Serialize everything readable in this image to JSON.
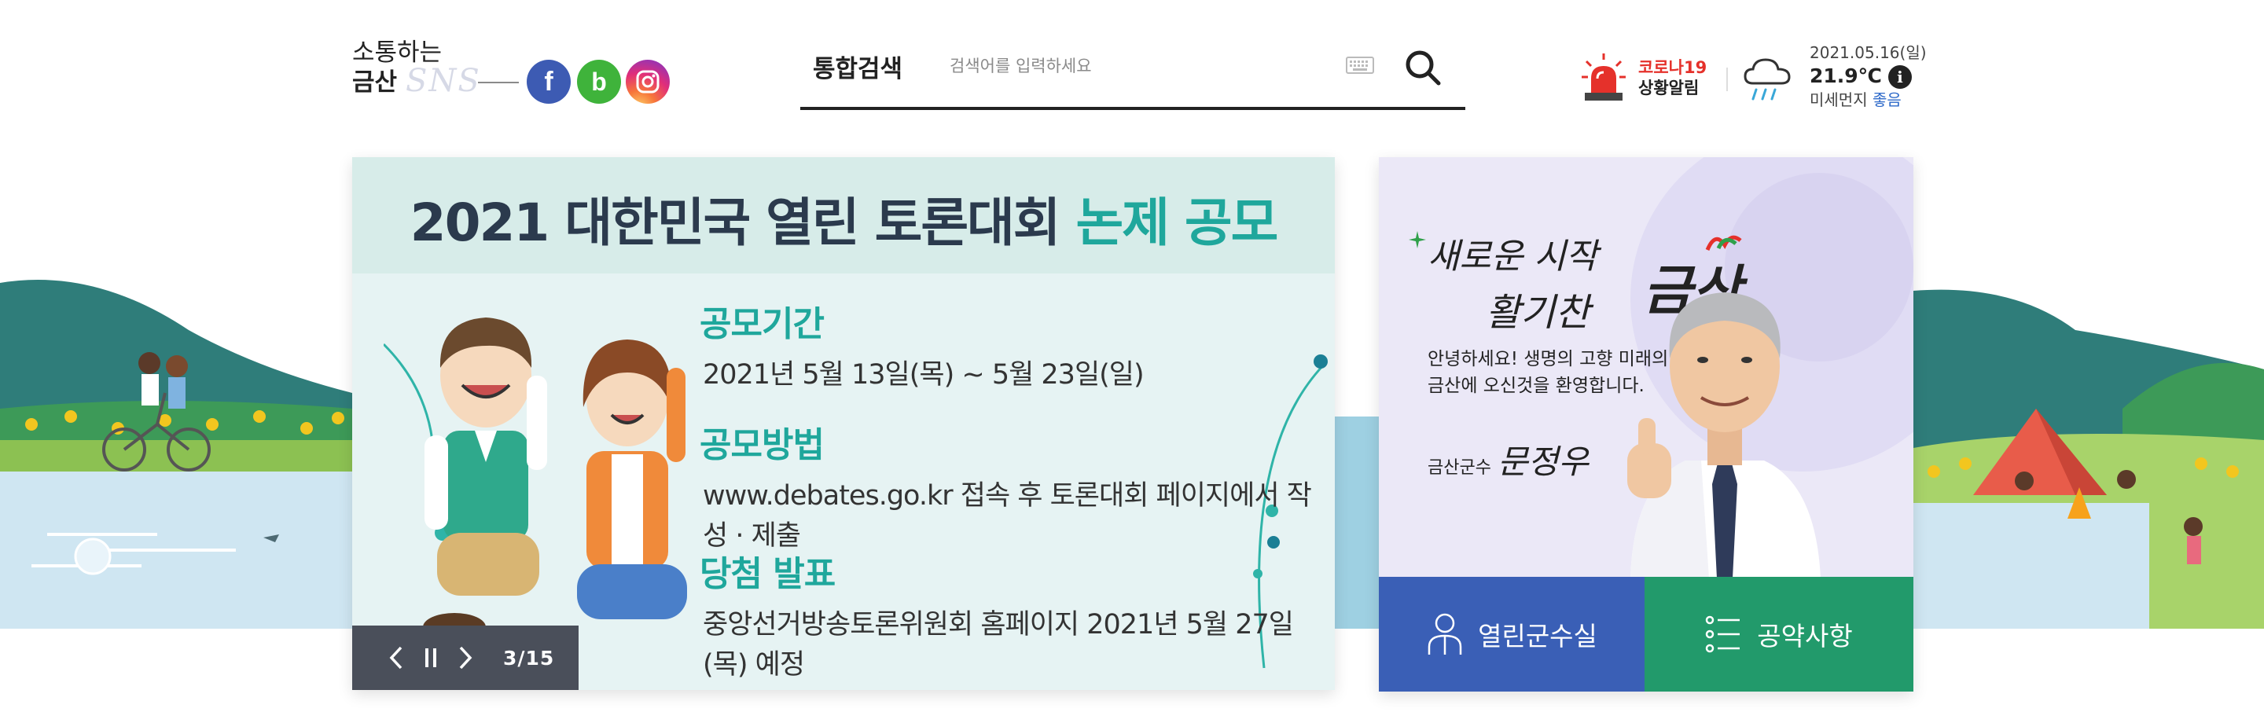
{
  "sns": {
    "title_line1": "소통하는",
    "title_line2": "금산",
    "title_deco": "SNS",
    "buttons": [
      {
        "icon": "facebook-icon",
        "glyph": "f",
        "color": "#3d5bb3"
      },
      {
        "icon": "band-icon",
        "glyph": "b",
        "color": "#3fb33b"
      },
      {
        "icon": "instagram-icon",
        "color": "#e12e79"
      }
    ]
  },
  "search": {
    "label": "통합검색",
    "placeholder": "검색어를 입력하세요",
    "value": ""
  },
  "alert": {
    "line1": "코로나19",
    "line2": "상황알림",
    "color": "#e5312b"
  },
  "weather": {
    "date": "2021.05.16(일)",
    "temperature": "21.9℃",
    "info_glyph": "i",
    "dust_label": "미세먼지",
    "dust_value": "좋음",
    "icon": "rain-cloud-icon"
  },
  "banner": {
    "title_main": "2021 대한민국 열린 토론대회 ",
    "title_highlight": "논제 공모",
    "sections": [
      {
        "heading": "공모기간",
        "text": "2021년 5월 13일(목) ~ 5월 23일(일)"
      },
      {
        "heading": "공모방법",
        "text": "www.debates.go.kr 접속 후 토론대회 페이지에서 작성 · 제출"
      },
      {
        "heading": "당첨 발표",
        "text": "중앙선거방송토론위원회 홈페이지 2021년 5월 27일(목) 예정"
      }
    ],
    "controls": {
      "current": 3,
      "total": 15,
      "counter_text": "3/15"
    },
    "accent_color": "#1fa79c"
  },
  "mayor": {
    "calligraphy_line1": "새로운 시작",
    "calligraphy_line2": "활기찬",
    "calligraphy_city": "금산",
    "greeting_line1": "안녕하세요! 생명의 고향 미래의 땅",
    "greeting_line2": "금산에 오신것을 환영합니다.",
    "signature_title": "금산군수",
    "signature_name": "문정우",
    "buttons": [
      {
        "label": "열린군수실",
        "icon": "person-icon",
        "color": "#3a5fb6"
      },
      {
        "label": "공약사항",
        "icon": "list-icon",
        "color": "#229a6b"
      }
    ]
  }
}
